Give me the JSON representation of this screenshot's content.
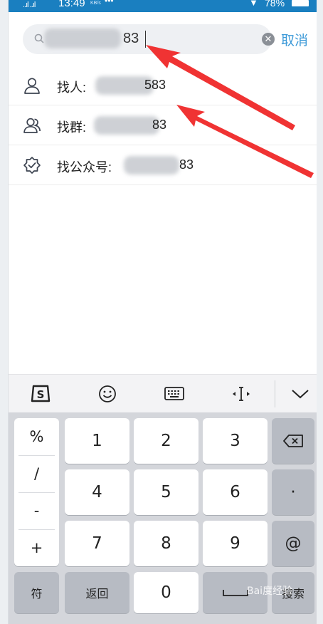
{
  "status_bar": {
    "signal": "..ıl ..ıl",
    "time": "13:49",
    "speed_unit": "KB/s",
    "battery": "78%"
  },
  "search": {
    "value_suffix": "83",
    "cancel_label": "取消"
  },
  "results": [
    {
      "label": "找人:",
      "suffix": "583",
      "icon": "person-icon"
    },
    {
      "label": "找群:",
      "suffix": "83",
      "icon": "group-icon"
    },
    {
      "label": "找公众号:",
      "suffix": "83",
      "icon": "badge-check-icon"
    }
  ],
  "keyboard": {
    "symbols": [
      "%",
      "/",
      "-",
      "+"
    ],
    "digits": [
      "1",
      "2",
      "3",
      "4",
      "5",
      "6",
      "7",
      "8",
      "9",
      "0"
    ],
    "dot": "·",
    "at": "@",
    "fu": "符",
    "back": "返回",
    "search": "搜索"
  },
  "watermark": "Bai度经验"
}
